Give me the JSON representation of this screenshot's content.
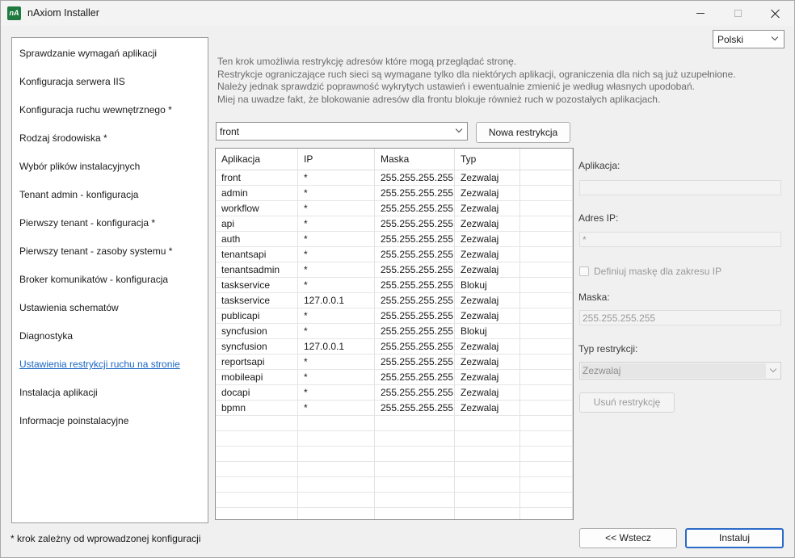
{
  "window": {
    "title": "nAxiom Installer",
    "icon_text": "nA"
  },
  "language": {
    "selected": "Polski"
  },
  "steps": [
    {
      "label": "Sprawdzanie wymagań aplikacji"
    },
    {
      "label": "Konfiguracja serwera IIS"
    },
    {
      "label": "Konfiguracja ruchu wewnętrznego *"
    },
    {
      "label": "Rodzaj środowiska *"
    },
    {
      "label": "Wybór plików instalacyjnych"
    },
    {
      "label": "Tenant admin - konfiguracja"
    },
    {
      "label": "Pierwszy tenant - konfiguracja *"
    },
    {
      "label": "Pierwszy tenant - zasoby systemu *"
    },
    {
      "label": "Broker komunikatów - konfiguracja"
    },
    {
      "label": "Ustawienia schematów"
    },
    {
      "label": "Diagnostyka"
    },
    {
      "label": "Ustawienia restrykcji ruchu na stronie"
    },
    {
      "label": "Instalacja aplikacji"
    },
    {
      "label": "Informacje poinstalacyjne"
    }
  ],
  "footnote": "* krok zależny od wprowadzonej konfiguracji",
  "intro": [
    "Ten krok umożliwia restrykcję adresów które mogą przeglądać stronę.",
    "Restrykcje ograniczające ruch sieci są wymagane tylko dla niektórych aplikacji, ograniczenia dla nich są już uzupełnione.",
    "Należy jednak sprawdzić poprawność wykrytych ustawień i ewentualnie zmienić je według własnych upodobań.",
    "Miej na uwadze fakt, że blokowanie adresów dla frontu blokuje również ruch w pozostałych aplikacjach."
  ],
  "app_select": {
    "value": "front"
  },
  "new_restriction_label": "Nowa restrykcja",
  "table": {
    "headers": [
      "Aplikacja",
      "IP",
      "Maska",
      "Typ"
    ],
    "rows": [
      [
        "front",
        "*",
        "255.255.255.255",
        "Zezwalaj"
      ],
      [
        "admin",
        "*",
        "255.255.255.255",
        "Zezwalaj"
      ],
      [
        "workflow",
        "*",
        "255.255.255.255",
        "Zezwalaj"
      ],
      [
        "api",
        "*",
        "255.255.255.255",
        "Zezwalaj"
      ],
      [
        "auth",
        "*",
        "255.255.255.255",
        "Zezwalaj"
      ],
      [
        "tenantsapi",
        "*",
        "255.255.255.255",
        "Zezwalaj"
      ],
      [
        "tenantsadmin",
        "*",
        "255.255.255.255",
        "Zezwalaj"
      ],
      [
        "taskservice",
        "*",
        "255.255.255.255",
        "Blokuj"
      ],
      [
        "taskservice",
        "127.0.0.1",
        "255.255.255.255",
        "Zezwalaj"
      ],
      [
        "publicapi",
        "*",
        "255.255.255.255",
        "Zezwalaj"
      ],
      [
        "syncfusion",
        "*",
        "255.255.255.255",
        "Blokuj"
      ],
      [
        "syncfusion",
        "127.0.0.1",
        "255.255.255.255",
        "Zezwalaj"
      ],
      [
        "reportsapi",
        "*",
        "255.255.255.255",
        "Zezwalaj"
      ],
      [
        "mobileapi",
        "*",
        "255.255.255.255",
        "Zezwalaj"
      ],
      [
        "docapi",
        "*",
        "255.255.255.255",
        "Zezwalaj"
      ],
      [
        "bpmn",
        "*",
        "255.255.255.255",
        "Zezwalaj"
      ]
    ]
  },
  "details": {
    "app_label": "Aplikacja:",
    "app_value": "",
    "ip_label": "Adres IP:",
    "ip_value": "*",
    "mask_checkbox_label": "Definiuj maskę dla zakresu IP",
    "mask_label": "Maska:",
    "mask_value": "255.255.255.255",
    "type_label": "Typ restrykcji:",
    "type_value": "Zezwalaj",
    "remove_label": "Usuń restrykcję"
  },
  "nav": {
    "back_label": "<< Wstecz",
    "install_label": "Instaluj"
  }
}
